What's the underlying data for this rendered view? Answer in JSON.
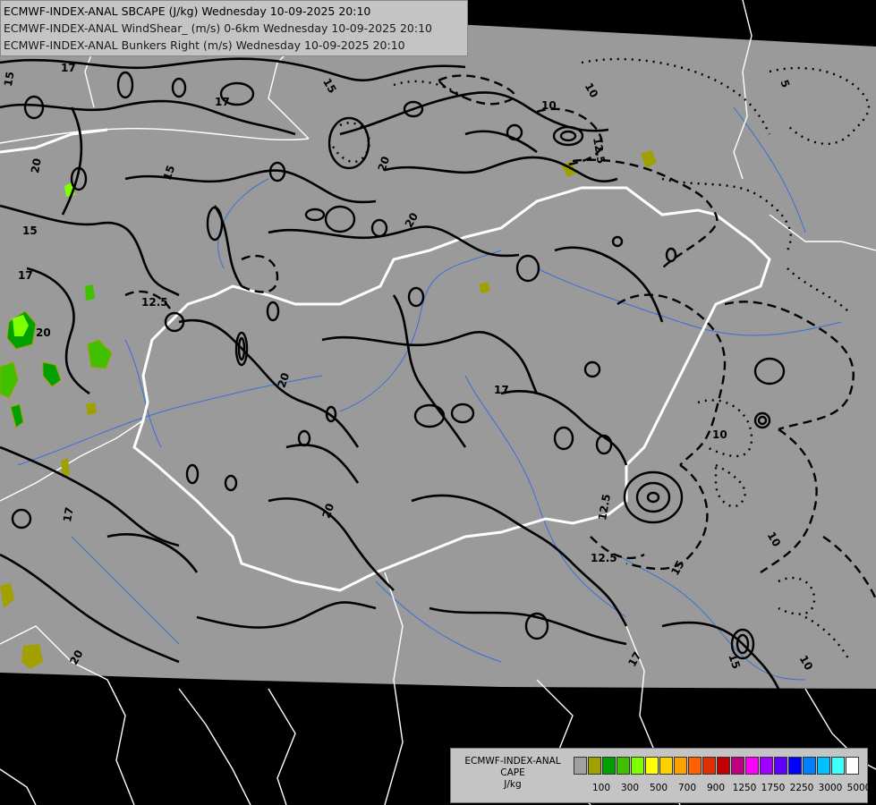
{
  "header": {
    "line1": "ECMWF-INDEX-ANAL SBCAPE (J/kg) Wednesday 10-09-2025 20:10",
    "line2": "ECMWF-INDEX-ANAL WindShear_ (m/s) 0-6km Wednesday 10-09-2025 20:10",
    "line3": "ECMWF-INDEX-ANAL Bunkers Right (m/s) Wednesday 10-09-2025 20:10"
  },
  "map": {
    "contour_labels": [
      "17",
      "15",
      "20",
      "15",
      "17",
      "15",
      "12.5",
      "17",
      "20",
      "15",
      "20",
      "17",
      "20",
      "12.5",
      "10",
      "10",
      "12.5",
      "5",
      "10",
      "15",
      "20",
      "10",
      "12.5",
      "17",
      "20",
      "20",
      "17",
      "15",
      "10"
    ]
  },
  "legend": {
    "title_1": "ECMWF-INDEX-ANAL",
    "title_2": "CAPE",
    "unit": "J/kg",
    "ticks": [
      "100",
      "300",
      "500",
      "700",
      "900",
      "1250",
      "1750",
      "2250",
      "3000",
      "5000"
    ],
    "colors": [
      "#a0a0a0",
      "#a0a000",
      "#00a000",
      "#40c000",
      "#80ff00",
      "#ffff00",
      "#ffd000",
      "#ffa000",
      "#ff6000",
      "#e03000",
      "#c00000",
      "#c00080",
      "#ff00ff",
      "#a000ff",
      "#6000ff",
      "#0000ff",
      "#0080ff",
      "#00c0ff",
      "#40ffff",
      "#ffffff"
    ]
  }
}
